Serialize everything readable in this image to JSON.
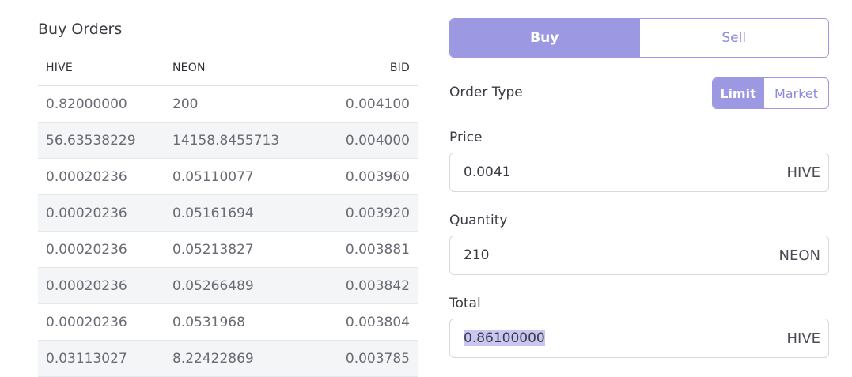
{
  "orders": {
    "title": "Buy Orders",
    "columns": [
      "HIVE",
      "NEON",
      "BID"
    ],
    "rows": [
      [
        "0.82000000",
        "200",
        "0.004100"
      ],
      [
        "56.63538229",
        "14158.8455713",
        "0.004000"
      ],
      [
        "0.00020236",
        "0.05110077",
        "0.003960"
      ],
      [
        "0.00020236",
        "0.05161694",
        "0.003920"
      ],
      [
        "0.00020236",
        "0.05213827",
        "0.003881"
      ],
      [
        "0.00020236",
        "0.05266489",
        "0.003842"
      ],
      [
        "0.00020236",
        "0.0531968",
        "0.003804"
      ],
      [
        "0.03113027",
        "8.22422869",
        "0.003785"
      ]
    ]
  },
  "form": {
    "side": {
      "buy_label": "Buy",
      "sell_label": "Sell",
      "selected": "Buy"
    },
    "order_type": {
      "label": "Order Type",
      "limit_label": "Limit",
      "market_label": "Market",
      "selected": "Limit"
    },
    "price": {
      "label": "Price",
      "value": "0.0041",
      "unit": "HIVE"
    },
    "quantity": {
      "label": "Quantity",
      "value": "210",
      "unit": "NEON"
    },
    "total": {
      "label": "Total",
      "value": "0.86100000",
      "unit": "HIVE"
    }
  },
  "colors": {
    "accent": "#9c99e2",
    "accent_text": "#8e8ad8",
    "selection_highlight": "#c9c6f2",
    "row_alt": "#f4f5f7"
  }
}
